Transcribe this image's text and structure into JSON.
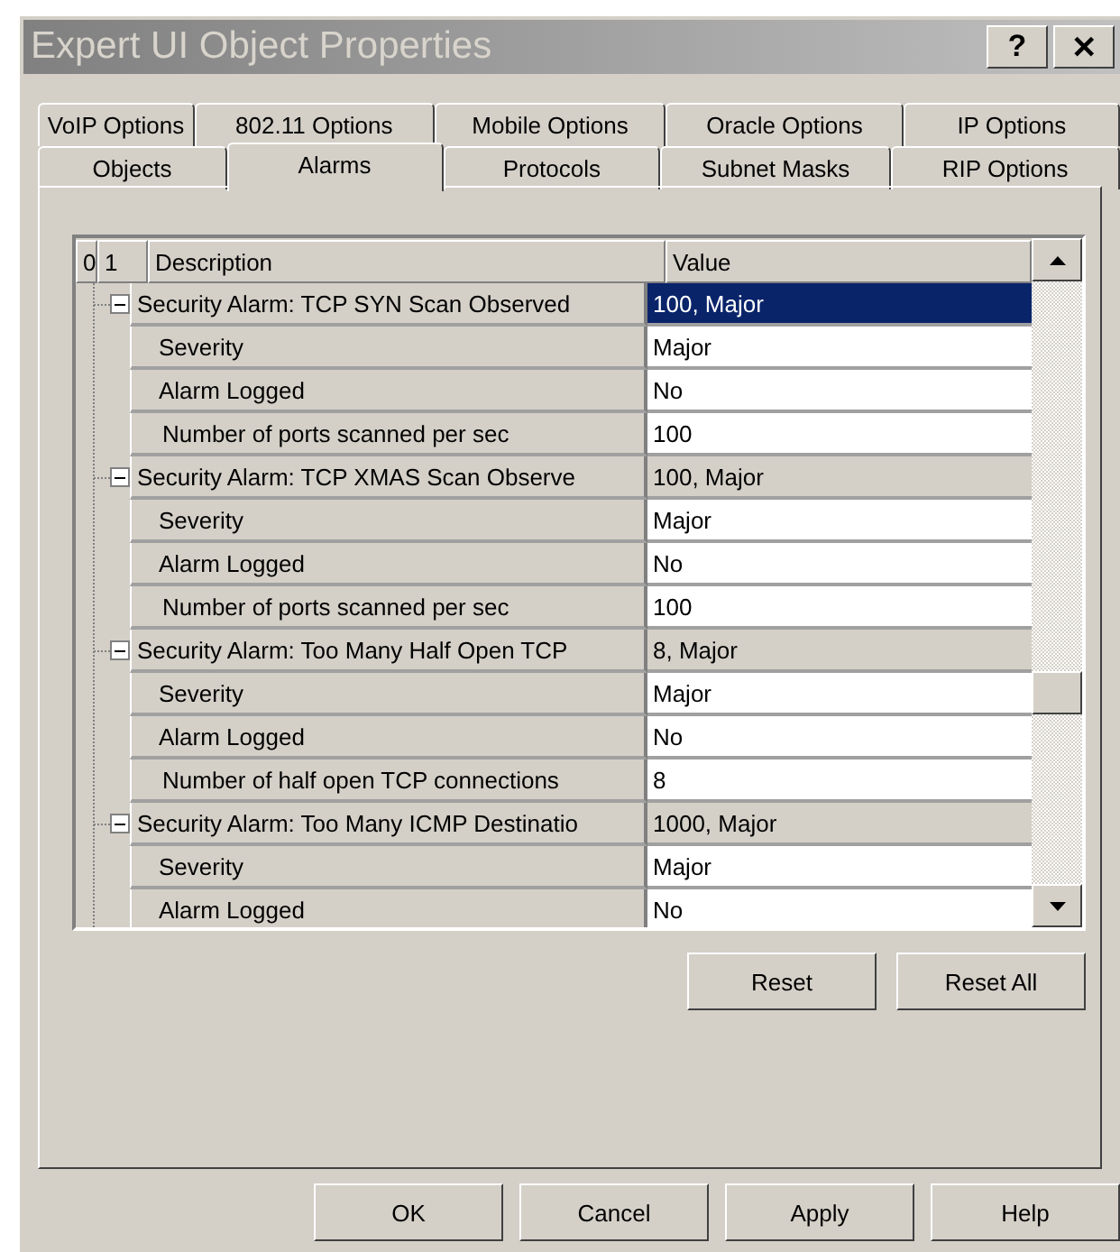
{
  "window": {
    "title": "Expert UI Object Properties",
    "help_button": "?",
    "close_button": "✕"
  },
  "tab_rows": [
    [
      {
        "label": "VoIP Options",
        "selected": false
      },
      {
        "label": "802.11 Options",
        "selected": false
      },
      {
        "label": "Mobile Options",
        "selected": false
      },
      {
        "label": "Oracle Options",
        "selected": false
      },
      {
        "label": "IP Options",
        "selected": false
      }
    ],
    [
      {
        "label": "Objects",
        "selected": false
      },
      {
        "label": "Alarms",
        "selected": true
      },
      {
        "label": "Protocols",
        "selected": false
      },
      {
        "label": "Subnet Masks",
        "selected": false
      },
      {
        "label": "RIP Options",
        "selected": false
      }
    ]
  ],
  "grid": {
    "level_headers": [
      "0",
      "1"
    ],
    "columns": [
      "Description",
      "Value"
    ],
    "groups": [
      {
        "description": "Security Alarm: TCP SYN Scan Observed",
        "value": "100, Major",
        "expanded": true,
        "selected": true,
        "children": [
          {
            "description": "Severity",
            "value": "Major"
          },
          {
            "description": "Alarm Logged",
            "value": "No"
          },
          {
            "description": "Number of ports scanned per sec",
            "value": "100"
          }
        ]
      },
      {
        "description": "Security Alarm: TCP XMAS Scan Observe",
        "value": "100, Major",
        "expanded": true,
        "selected": false,
        "children": [
          {
            "description": "Severity",
            "value": "Major"
          },
          {
            "description": "Alarm Logged",
            "value": "No"
          },
          {
            "description": "Number of ports scanned per sec",
            "value": "100"
          }
        ]
      },
      {
        "description": "Security Alarm: Too Many Half Open TCP",
        "value": "8, Major",
        "expanded": true,
        "selected": false,
        "children": [
          {
            "description": "Severity",
            "value": "Major"
          },
          {
            "description": "Alarm Logged",
            "value": "No"
          },
          {
            "description": "Number of half open TCP connections",
            "value": "8"
          }
        ]
      },
      {
        "description": "Security Alarm: Too Many ICMP Destinatio",
        "value": "1000, Major",
        "expanded": true,
        "selected": false,
        "children": [
          {
            "description": "Severity",
            "value": "Major"
          },
          {
            "description": "Alarm Logged",
            "value": "No"
          }
        ]
      }
    ]
  },
  "panel_buttons": [
    "Reset",
    "Reset All"
  ],
  "dialog_buttons": [
    "OK",
    "Cancel",
    "Apply",
    "Help"
  ]
}
